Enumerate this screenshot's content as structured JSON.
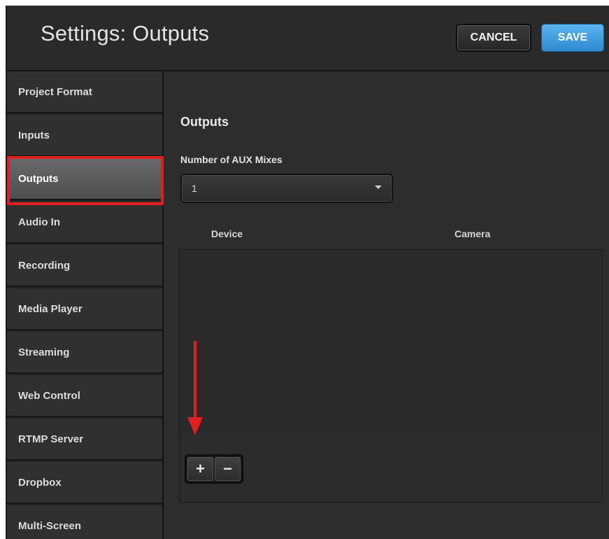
{
  "header": {
    "title": "Settings: Outputs",
    "cancel_label": "CANCEL",
    "save_label": "SAVE"
  },
  "sidebar": {
    "items": [
      {
        "label": "Project Format"
      },
      {
        "label": "Inputs"
      },
      {
        "label": "Outputs",
        "active": true
      },
      {
        "label": "Audio In"
      },
      {
        "label": "Recording"
      },
      {
        "label": "Media Player"
      },
      {
        "label": "Streaming"
      },
      {
        "label": "Web Control"
      },
      {
        "label": "RTMP Server"
      },
      {
        "label": "Dropbox"
      },
      {
        "label": "Multi-Screen"
      }
    ]
  },
  "main": {
    "section_title": "Outputs",
    "aux_label": "Number of AUX Mixes",
    "aux_value": "1",
    "columns": [
      "Device",
      "Camera"
    ],
    "rows": [],
    "add_symbol": "+",
    "remove_symbol": "−"
  },
  "colors": {
    "accent": "#2f8ad2",
    "highlight": "#e31e1e",
    "background": "#2d2d2d"
  },
  "icons": {
    "dropdown": "chevron-down-icon",
    "add": "plus-icon",
    "remove": "minus-icon"
  }
}
